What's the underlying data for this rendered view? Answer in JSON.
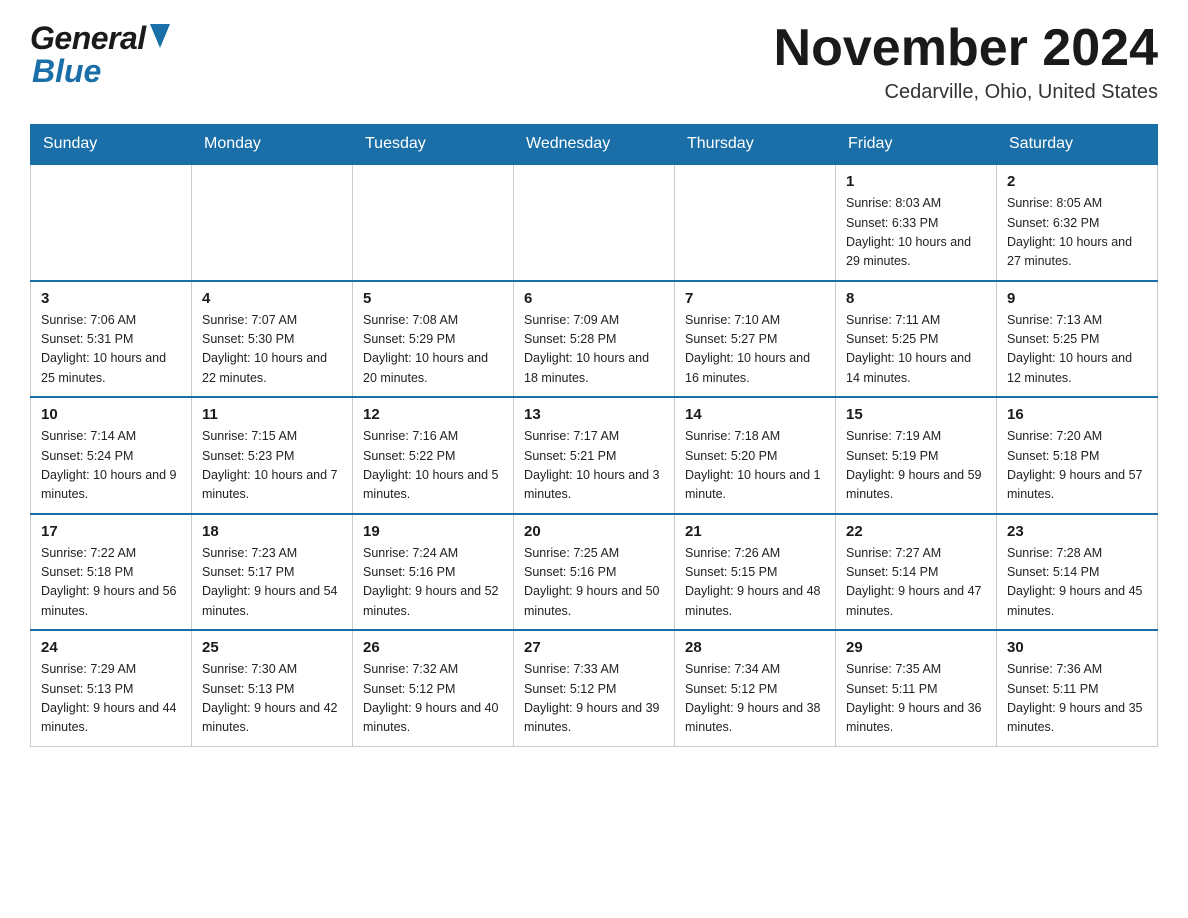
{
  "header": {
    "logo_general": "General",
    "logo_blue": "Blue",
    "month_title": "November 2024",
    "location": "Cedarville, Ohio, United States"
  },
  "calendar": {
    "days_of_week": [
      "Sunday",
      "Monday",
      "Tuesday",
      "Wednesday",
      "Thursday",
      "Friday",
      "Saturday"
    ],
    "weeks": [
      [
        {
          "day": "",
          "info": ""
        },
        {
          "day": "",
          "info": ""
        },
        {
          "day": "",
          "info": ""
        },
        {
          "day": "",
          "info": ""
        },
        {
          "day": "",
          "info": ""
        },
        {
          "day": "1",
          "info": "Sunrise: 8:03 AM\nSunset: 6:33 PM\nDaylight: 10 hours and 29 minutes."
        },
        {
          "day": "2",
          "info": "Sunrise: 8:05 AM\nSunset: 6:32 PM\nDaylight: 10 hours and 27 minutes."
        }
      ],
      [
        {
          "day": "3",
          "info": "Sunrise: 7:06 AM\nSunset: 5:31 PM\nDaylight: 10 hours and 25 minutes."
        },
        {
          "day": "4",
          "info": "Sunrise: 7:07 AM\nSunset: 5:30 PM\nDaylight: 10 hours and 22 minutes."
        },
        {
          "day": "5",
          "info": "Sunrise: 7:08 AM\nSunset: 5:29 PM\nDaylight: 10 hours and 20 minutes."
        },
        {
          "day": "6",
          "info": "Sunrise: 7:09 AM\nSunset: 5:28 PM\nDaylight: 10 hours and 18 minutes."
        },
        {
          "day": "7",
          "info": "Sunrise: 7:10 AM\nSunset: 5:27 PM\nDaylight: 10 hours and 16 minutes."
        },
        {
          "day": "8",
          "info": "Sunrise: 7:11 AM\nSunset: 5:25 PM\nDaylight: 10 hours and 14 minutes."
        },
        {
          "day": "9",
          "info": "Sunrise: 7:13 AM\nSunset: 5:25 PM\nDaylight: 10 hours and 12 minutes."
        }
      ],
      [
        {
          "day": "10",
          "info": "Sunrise: 7:14 AM\nSunset: 5:24 PM\nDaylight: 10 hours and 9 minutes."
        },
        {
          "day": "11",
          "info": "Sunrise: 7:15 AM\nSunset: 5:23 PM\nDaylight: 10 hours and 7 minutes."
        },
        {
          "day": "12",
          "info": "Sunrise: 7:16 AM\nSunset: 5:22 PM\nDaylight: 10 hours and 5 minutes."
        },
        {
          "day": "13",
          "info": "Sunrise: 7:17 AM\nSunset: 5:21 PM\nDaylight: 10 hours and 3 minutes."
        },
        {
          "day": "14",
          "info": "Sunrise: 7:18 AM\nSunset: 5:20 PM\nDaylight: 10 hours and 1 minute."
        },
        {
          "day": "15",
          "info": "Sunrise: 7:19 AM\nSunset: 5:19 PM\nDaylight: 9 hours and 59 minutes."
        },
        {
          "day": "16",
          "info": "Sunrise: 7:20 AM\nSunset: 5:18 PM\nDaylight: 9 hours and 57 minutes."
        }
      ],
      [
        {
          "day": "17",
          "info": "Sunrise: 7:22 AM\nSunset: 5:18 PM\nDaylight: 9 hours and 56 minutes."
        },
        {
          "day": "18",
          "info": "Sunrise: 7:23 AM\nSunset: 5:17 PM\nDaylight: 9 hours and 54 minutes."
        },
        {
          "day": "19",
          "info": "Sunrise: 7:24 AM\nSunset: 5:16 PM\nDaylight: 9 hours and 52 minutes."
        },
        {
          "day": "20",
          "info": "Sunrise: 7:25 AM\nSunset: 5:16 PM\nDaylight: 9 hours and 50 minutes."
        },
        {
          "day": "21",
          "info": "Sunrise: 7:26 AM\nSunset: 5:15 PM\nDaylight: 9 hours and 48 minutes."
        },
        {
          "day": "22",
          "info": "Sunrise: 7:27 AM\nSunset: 5:14 PM\nDaylight: 9 hours and 47 minutes."
        },
        {
          "day": "23",
          "info": "Sunrise: 7:28 AM\nSunset: 5:14 PM\nDaylight: 9 hours and 45 minutes."
        }
      ],
      [
        {
          "day": "24",
          "info": "Sunrise: 7:29 AM\nSunset: 5:13 PM\nDaylight: 9 hours and 44 minutes."
        },
        {
          "day": "25",
          "info": "Sunrise: 7:30 AM\nSunset: 5:13 PM\nDaylight: 9 hours and 42 minutes."
        },
        {
          "day": "26",
          "info": "Sunrise: 7:32 AM\nSunset: 5:12 PM\nDaylight: 9 hours and 40 minutes."
        },
        {
          "day": "27",
          "info": "Sunrise: 7:33 AM\nSunset: 5:12 PM\nDaylight: 9 hours and 39 minutes."
        },
        {
          "day": "28",
          "info": "Sunrise: 7:34 AM\nSunset: 5:12 PM\nDaylight: 9 hours and 38 minutes."
        },
        {
          "day": "29",
          "info": "Sunrise: 7:35 AM\nSunset: 5:11 PM\nDaylight: 9 hours and 36 minutes."
        },
        {
          "day": "30",
          "info": "Sunrise: 7:36 AM\nSunset: 5:11 PM\nDaylight: 9 hours and 35 minutes."
        }
      ]
    ]
  }
}
